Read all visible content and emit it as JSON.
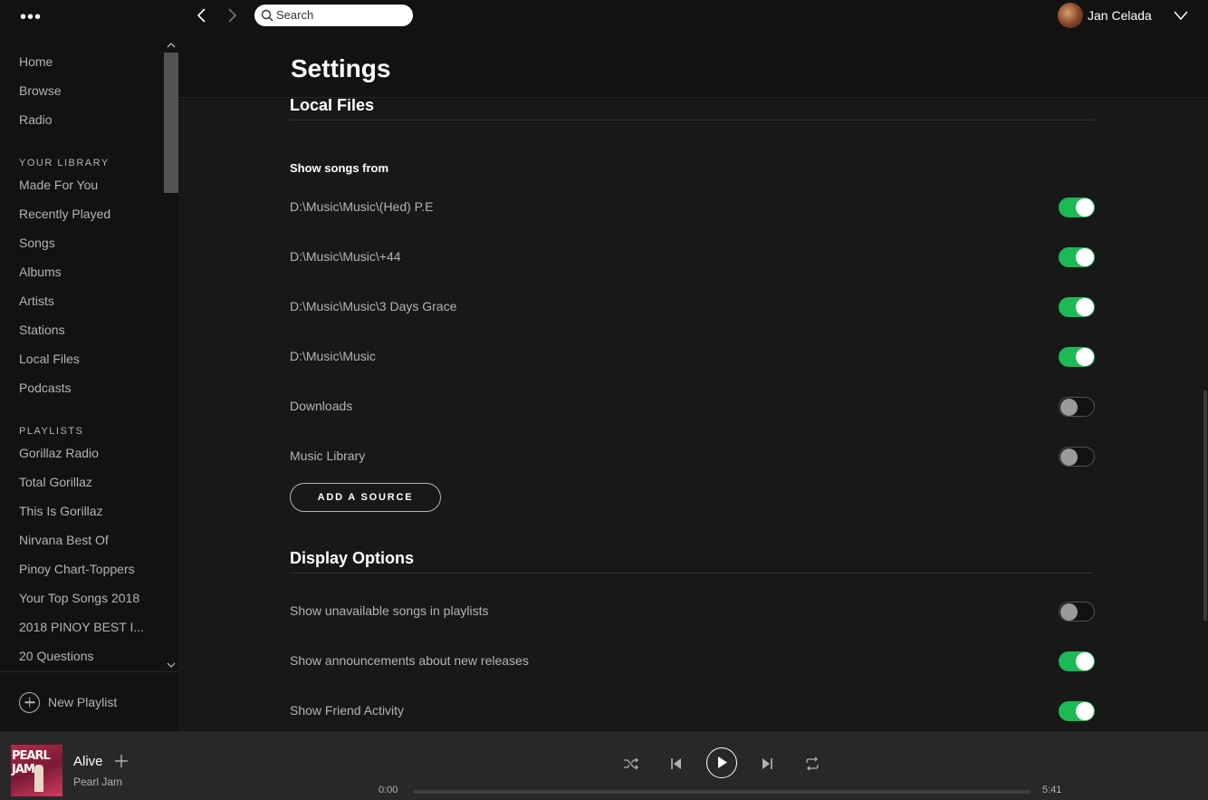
{
  "sidebar": {
    "menu_icon_glyph": "•••",
    "main_nav": [
      "Home",
      "Browse",
      "Radio"
    ],
    "library_header": "YOUR LIBRARY",
    "library_items": [
      "Made For You",
      "Recently Played",
      "Songs",
      "Albums",
      "Artists",
      "Stations",
      "Local Files",
      "Podcasts"
    ],
    "playlists_header": "PLAYLISTS",
    "playlists": [
      "Gorillaz Radio",
      "Total Gorillaz",
      "This Is Gorillaz",
      "Nirvana Best Of",
      "Pinoy Chart-Toppers",
      "Your Top Songs 2018",
      "2018 PINOY BEST I...",
      "20 Questions"
    ],
    "new_playlist_label": "New Playlist"
  },
  "topbar": {
    "search_placeholder": "Search",
    "user_name": "Jan Celada"
  },
  "settings": {
    "page_title": "Settings",
    "local_files": {
      "title": "Local Files",
      "subtitle": "Show songs from",
      "sources": [
        {
          "label": "D:\\Music\\Music\\(Hed) P.E",
          "enabled": true
        },
        {
          "label": "D:\\Music\\Music\\+44",
          "enabled": true
        },
        {
          "label": "D:\\Music\\Music\\3 Days Grace",
          "enabled": true
        },
        {
          "label": "D:\\Music\\Music",
          "enabled": true
        },
        {
          "label": "Downloads",
          "enabled": false
        },
        {
          "label": "Music Library",
          "enabled": false
        }
      ],
      "add_source_label": "ADD A SOURCE"
    },
    "display_options": {
      "title": "Display Options",
      "options": [
        {
          "label": "Show unavailable songs in playlists",
          "enabled": false
        },
        {
          "label": "Show announcements about new releases",
          "enabled": true
        },
        {
          "label": "Show Friend Activity",
          "enabled": true
        }
      ]
    }
  },
  "player": {
    "album_art_text": "PEARL JAM",
    "track_title": "Alive",
    "track_artist": "Pearl Jam",
    "time_current": "0:00",
    "time_total": "5:41",
    "progress_fraction": 0.0
  },
  "colors": {
    "accent_green": "#1db954",
    "background": "#121212",
    "content_background": "#181818",
    "player_background": "#282828"
  }
}
